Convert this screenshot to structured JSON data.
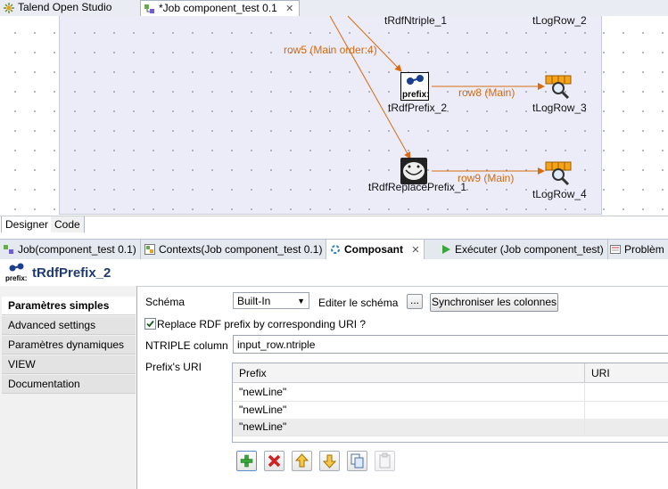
{
  "top_tabs": [
    {
      "label": "Talend Open Studio"
    },
    {
      "label": "*Job component_test 0.1"
    }
  ],
  "canvas": {
    "nodes": [
      {
        "label": "tRdfNtriple_1"
      },
      {
        "label": "tLogRow_2"
      },
      {
        "label": "tRdfPrefix_2"
      },
      {
        "label": "tLogRow_3"
      },
      {
        "label": "tRdfReplacePrefix_1"
      },
      {
        "label": "tLogRow_4"
      }
    ],
    "links": [
      {
        "label": "row5 (Main order:4)"
      },
      {
        "label": "row8 (Main)"
      },
      {
        "label": "row9 (Main)"
      }
    ],
    "link_color": "#d96b10"
  },
  "editor_tabs": [
    {
      "label": "Designer"
    },
    {
      "label": "Code"
    }
  ],
  "bottom_tabs": [
    {
      "label": "Job(component_test 0.1)"
    },
    {
      "label": "Contexts(Job component_test 0.1)"
    },
    {
      "label": "Composant"
    },
    {
      "label": "Exécuter (Job component_test)"
    },
    {
      "label": "Problèm"
    }
  ],
  "component": {
    "title": "tRdfPrefix_2",
    "title_color": "#1d3b71"
  },
  "side_menu": [
    {
      "label": "Paramètres simples"
    },
    {
      "label": "Advanced settings"
    },
    {
      "label": "Paramètres dynamiques"
    },
    {
      "label": "VIEW"
    },
    {
      "label": "Documentation"
    }
  ],
  "form": {
    "schema_label": "Schéma",
    "schema_value": "Built-In",
    "edit_schema_label": "Editer le schéma",
    "edit_schema_button": "...",
    "sync_button": "Synchroniser les colonnes",
    "replace_checkbox_label": "Replace RDF prefix by corresponding URI ?",
    "replace_checked": true,
    "ntriple_label": "NTRIPLE column",
    "ntriple_value": "input_row.ntriple",
    "prefix_uri_label": "Prefix's URI"
  },
  "table": {
    "columns": [
      "Prefix",
      "URI"
    ],
    "rows": [
      [
        "\"newLine\"",
        ""
      ],
      [
        "\"newLine\"",
        ""
      ],
      [
        "\"newLine\"",
        ""
      ]
    ]
  },
  "table_buttons": [
    {
      "icon": "add-icon"
    },
    {
      "icon": "delete-icon"
    },
    {
      "icon": "move-up-icon"
    },
    {
      "icon": "move-down-icon"
    },
    {
      "icon": "copy-icon"
    },
    {
      "icon": "paste-icon"
    }
  ]
}
